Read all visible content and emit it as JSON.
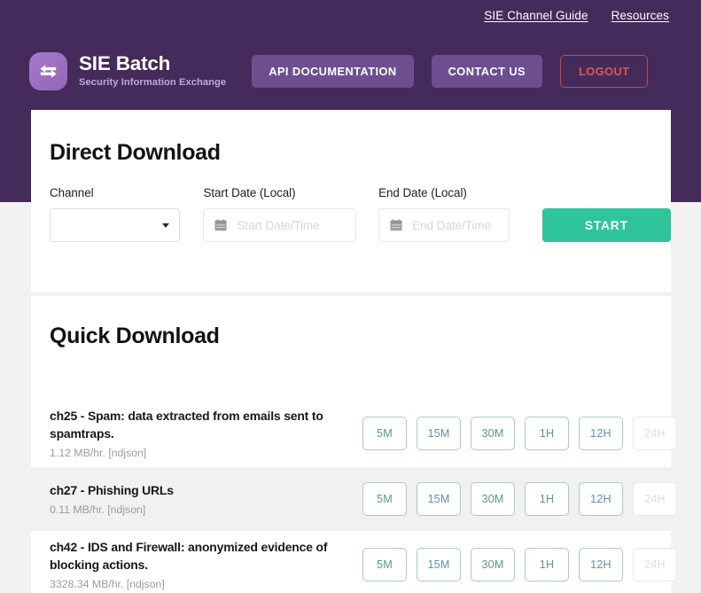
{
  "header": {
    "top_links": [
      {
        "label": "SIE Channel Guide",
        "name": "sie-channel-guide-link"
      },
      {
        "label": "Resources",
        "name": "resources-link"
      }
    ],
    "brand_title": "SIE Batch",
    "brand_subtitle": "Security Information Exchange",
    "logo_icon": "exchange-arrows-icon",
    "buttons": {
      "api_documentation": "API DOCUMENTATION",
      "contact_us": "CONTACT US",
      "logout": "LOGOUT"
    },
    "colors": {
      "band": "#452a5c",
      "button": "#6d4f91",
      "logout_border": "#c9483f",
      "logout_text": "#e2564c",
      "logo_gradient_from": "#a779c8",
      "logo_gradient_to": "#9466b8"
    }
  },
  "direct_download": {
    "title": "Direct Download",
    "channel": {
      "label": "Channel",
      "value": "",
      "icon": "chevron-down-icon"
    },
    "start_date": {
      "label": "Start Date (Local)",
      "value": "",
      "placeholder": "Start Date/Time",
      "icon": "calendar-icon"
    },
    "end_date": {
      "label": "End Date (Local)",
      "value": "",
      "placeholder": "End Date/Time",
      "icon": "calendar-icon"
    },
    "start_button": {
      "label": "START",
      "color": "#2ec49c"
    }
  },
  "quick_download": {
    "title": "Quick Download",
    "durations": [
      {
        "label": "5M",
        "disabled": false
      },
      {
        "label": "15M",
        "disabled": false
      },
      {
        "label": "30M",
        "disabled": false
      },
      {
        "label": "1H",
        "disabled": false
      },
      {
        "label": "12H",
        "disabled": false
      },
      {
        "label": "24H",
        "disabled": true
      }
    ],
    "button_colors": {
      "border": "#a9c9cd",
      "text": "#5c93a2",
      "disabled_border": "#e7e8e9",
      "disabled_text": "#dcdddf"
    },
    "rows": [
      {
        "name": "ch25 - Spam: data extracted from emails sent to spamtraps.",
        "meta": "1.12 MB/hr. [ndjson]",
        "striped": false
      },
      {
        "name": "ch27 - Phishing URLs",
        "meta": "0.11 MB/hr. [ndjson]",
        "striped": true
      },
      {
        "name": "ch42 - IDS and Firewall: anonymized evidence of blocking actions.",
        "meta": "3328.34 MB/hr. [ndjson]",
        "striped": false
      }
    ]
  }
}
